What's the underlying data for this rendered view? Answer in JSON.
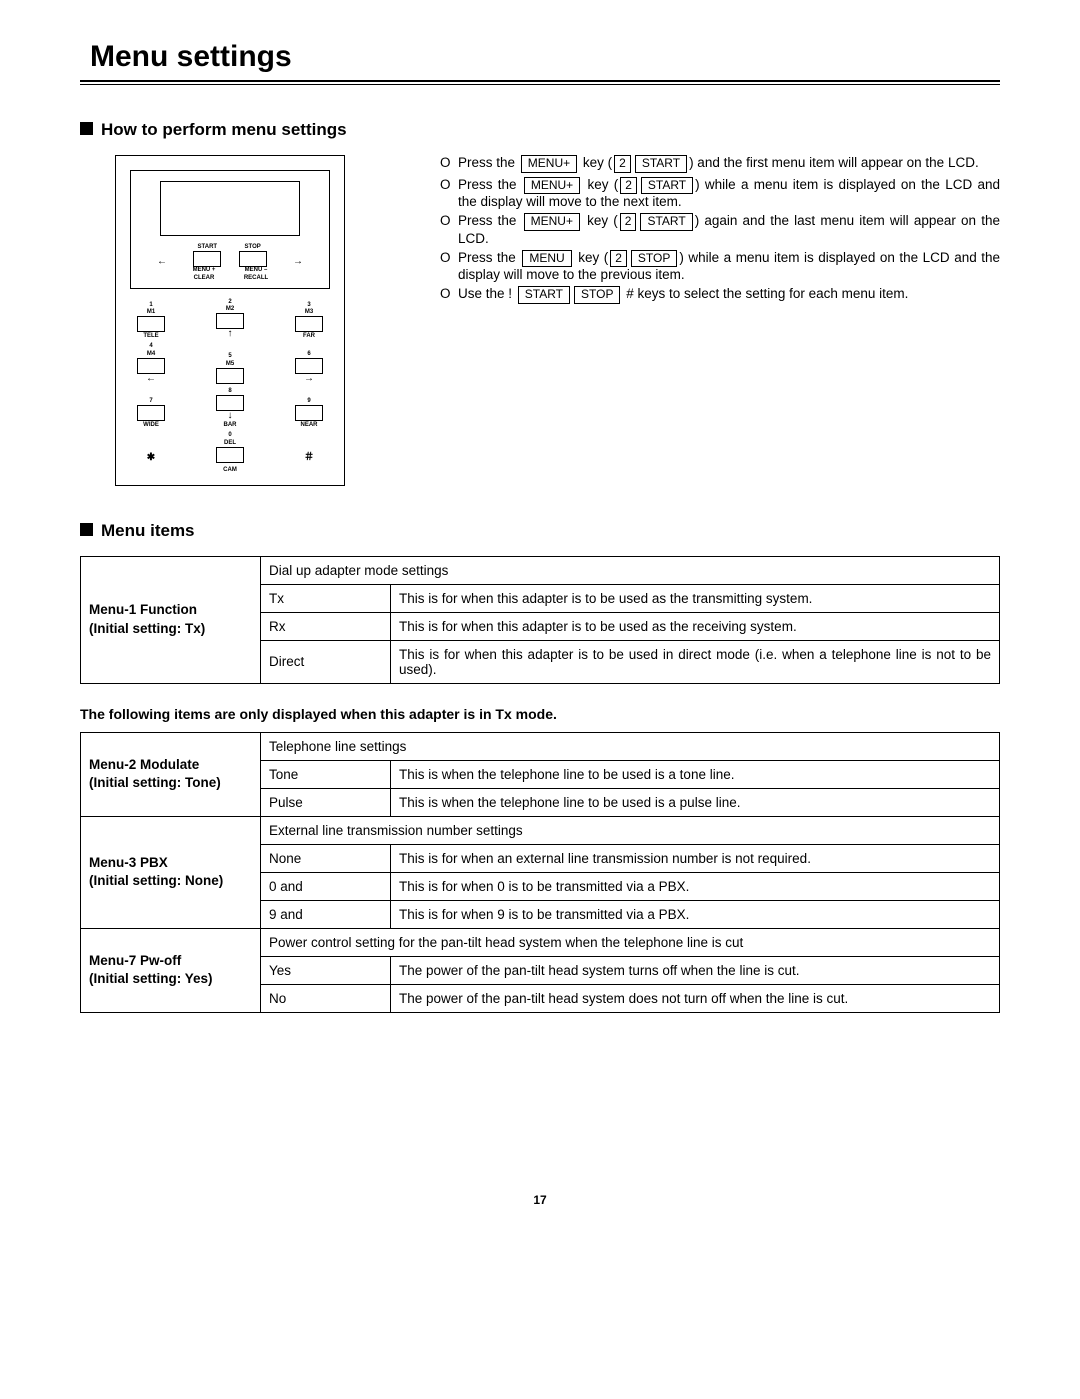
{
  "title": "Menu settings",
  "page_number": "17",
  "section1": {
    "heading": "How to perform menu settings",
    "keypad": {
      "row_a": [
        "START",
        "STOP"
      ],
      "row_b": [
        "MENU +",
        "MENU –"
      ],
      "row_c": [
        "CLEAR",
        "RECALL"
      ],
      "keys": [
        {
          "num": "1",
          "sub": "M1",
          "word": "TELE"
        },
        {
          "num": "2",
          "sub": "M2",
          "arrow": "↑"
        },
        {
          "num": "3",
          "sub": "M3",
          "word": "FAR"
        },
        {
          "num": "4",
          "sub": "M4",
          "arrow": "←"
        },
        {
          "num": "5",
          "sub": "M5"
        },
        {
          "num": "6",
          "arrow": "→"
        },
        {
          "num": "7",
          "word": "WIDE"
        },
        {
          "num": "8",
          "arrow": "↓",
          "word2": "BAR"
        },
        {
          "num": "9",
          "word": "NEAR"
        },
        {
          "sym": "✱"
        },
        {
          "num": "0",
          "sub": "DEL"
        },
        {
          "sym": "＃"
        }
      ],
      "cam": "CAM"
    },
    "instructions": [
      {
        "pre": "Press the ",
        "k1": "MENU+",
        "mid": " key (",
        "k2": "2",
        "k3": "START",
        "post": ") and the first menu item will appear on the LCD."
      },
      {
        "pre": "Press the ",
        "k1": "MENU+",
        "mid": " key (",
        "k2": "2",
        "k3": "START",
        "post": ") while a menu item is displayed on the LCD and the display will move to the next item."
      },
      {
        "pre": "Press the ",
        "k1": "MENU+",
        "mid": " key (",
        "k2": "2",
        "k3": "START",
        "post": ") again and the last menu item will appear on the LCD."
      },
      {
        "pre": "Press the ",
        "k1": "MENU",
        "mid": " key (",
        "k2": "2",
        "k3": "STOP",
        "post": ") while a menu item is displayed on the LCD and the display will move to the previous item."
      },
      {
        "pre": "Use the ! ",
        "k1": "START",
        "k2": "STOP",
        "post2": " # keys to select the setting for each menu item."
      }
    ]
  },
  "section2": {
    "heading": "Menu items",
    "table1": {
      "header": "Menu-1 Function\n(Initial setting: Tx)",
      "caption": "Dial up adapter mode settings",
      "rows": [
        {
          "opt": "Tx",
          "desc": "This is for when this adapter is to be used as the transmitting system."
        },
        {
          "opt": "Rx",
          "desc": "This is for when this adapter is to be used as the receiving system."
        },
        {
          "opt": "Direct",
          "desc": "This is for when this adapter is to be used in direct mode (i.e. when a telephone line is not to be used)."
        }
      ]
    },
    "note": "The following items are only displayed when this adapter is in Tx mode.",
    "table2": [
      {
        "header": "Menu-2 Modulate\n(Initial setting: Tone)",
        "caption": "Telephone line settings",
        "rows": [
          {
            "opt": "Tone",
            "desc": "This is when the telephone line to be used is a tone line."
          },
          {
            "opt": "Pulse",
            "desc": "This is when the telephone line to be used is a pulse line."
          }
        ]
      },
      {
        "header": "Menu-3 PBX\n(Initial setting: None)",
        "caption": "External line transmission number settings",
        "rows": [
          {
            "opt": "None",
            "desc": "This is for when an external line transmission number is not required."
          },
          {
            "opt": "0 and",
            "desc": "This is for when 0 is to be transmitted via a PBX."
          },
          {
            "opt": "9 and",
            "desc": "This is for when 9 is to be transmitted via a PBX."
          }
        ]
      },
      {
        "header": "Menu-7 Pw-off\n(Initial setting: Yes)",
        "caption": "Power control setting for the pan-tilt head system when the telephone line is cut",
        "rows": [
          {
            "opt": "Yes",
            "desc": "The power of the pan-tilt head system turns off when the line is cut."
          },
          {
            "opt": "No",
            "desc": "The power of the pan-tilt head system does not turn off when the line is cut."
          }
        ]
      }
    ]
  }
}
